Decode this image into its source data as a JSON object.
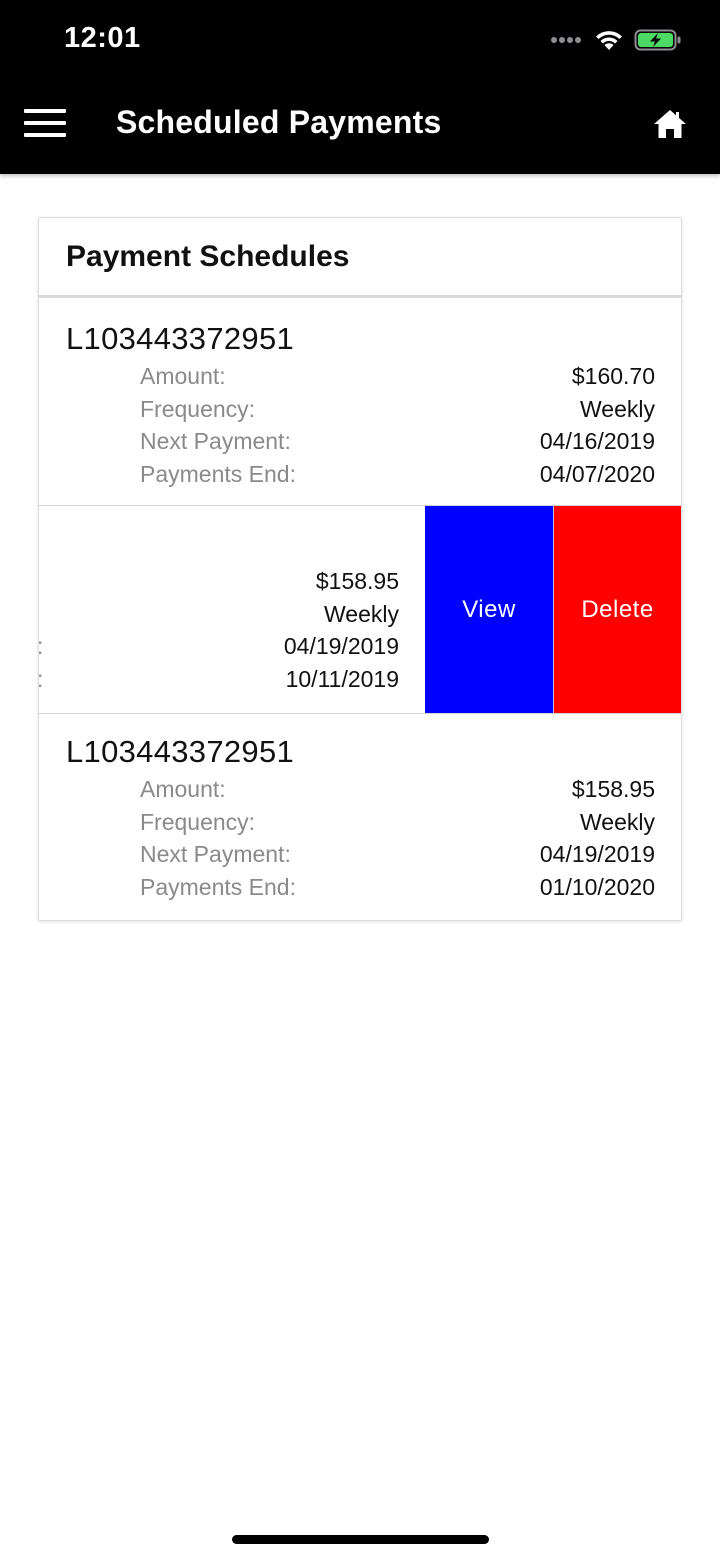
{
  "status_bar": {
    "time": "12:01",
    "icons": [
      "signal-dots-icon",
      "wifi-icon",
      "battery-charging-icon"
    ],
    "battery_color": "#4cd964"
  },
  "nav": {
    "title": "Scheduled Payments",
    "menu_icon": "hamburger-menu-icon",
    "home_icon": "home-icon"
  },
  "card": {
    "title": "Payment Schedules",
    "schedules": [
      {
        "loan_id": "L103443372951",
        "fields": [
          {
            "label": "Amount:",
            "value": "$160.70"
          },
          {
            "label": "Frequency:",
            "value": "Weekly"
          },
          {
            "label": "Next Payment:",
            "value": "04/16/2019"
          },
          {
            "label": "Payments End:",
            "value": "04/07/2020"
          }
        ]
      },
      {
        "swiped": true,
        "fields": [
          {
            "label": ":",
            "value": "$158.95"
          },
          {
            "label": ":",
            "value": "Weekly"
          },
          {
            "label": ":",
            "value": "04/19/2019"
          },
          {
            "label": ":",
            "value": "10/11/2019"
          }
        ],
        "actions": {
          "view": "View",
          "delete": "Delete"
        }
      },
      {
        "loan_id": "L103443372951",
        "fields": [
          {
            "label": "Amount:",
            "value": "$158.95"
          },
          {
            "label": "Frequency:",
            "value": "Weekly"
          },
          {
            "label": "Next Payment:",
            "value": "04/19/2019"
          },
          {
            "label": "Payments End:",
            "value": "01/10/2020"
          }
        ]
      }
    ]
  },
  "colors": {
    "view_action": "#0000ff",
    "delete_action": "#ff0000",
    "header_bg": "#000000"
  }
}
